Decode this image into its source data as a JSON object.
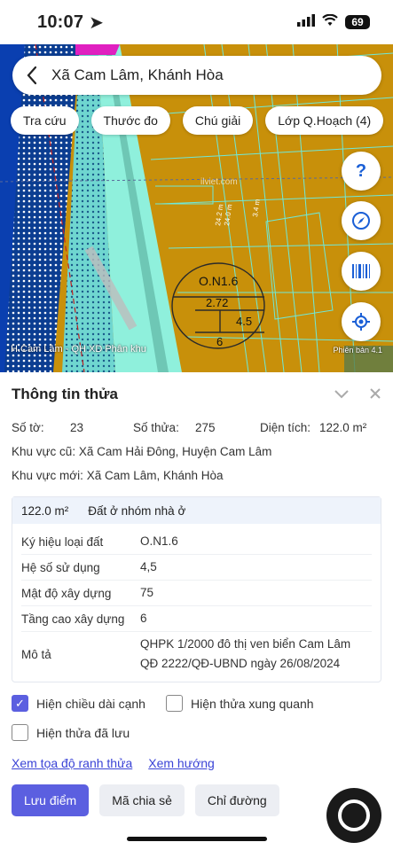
{
  "status": {
    "time": "10:07",
    "battery": "69"
  },
  "search": {
    "query": "Xã Cam Lâm, Khánh Hòa"
  },
  "chips": [
    "Tra cứu",
    "Thước đo",
    "Chú giải",
    "Lớp Q.Hoạch (4)"
  ],
  "map": {
    "watermark": "ilviet.com",
    "parcel_code": "O.N1.6",
    "parcel_far": "2.72",
    "parcel_ratio": "4.5",
    "parcel_floors": "6",
    "dim1": "24.2 m",
    "dim2": "24.0 m",
    "dim3": "3.4 m",
    "layer_label": "H.Cam Lâm - QH XD Phân khu",
    "version": "Phiên bản 4.1"
  },
  "info": {
    "title": "Thông tin thửa",
    "so_to_label": "Số tờ:",
    "so_to": "23",
    "so_thua_label": "Số thửa:",
    "so_thua": "275",
    "dien_tich_label": "Diện tích:",
    "dien_tich": "122.0 m²",
    "khu_vuc_cu_label": "Khu vực cũ:",
    "khu_vuc_cu": "Xã Cam Hải Đông, Huyện Cam Lâm",
    "khu_vuc_moi_label": "Khu vực mới:",
    "khu_vuc_moi": "Xã Cam Lâm, Khánh Hòa",
    "box_area": "122.0 m²",
    "box_type": "Đất ở nhóm nhà ở",
    "rows": [
      {
        "k": "Ký hiệu loại đất",
        "v": "O.N1.6"
      },
      {
        "k": "Hệ số sử dụng",
        "v": "4,5"
      },
      {
        "k": "Mật độ xây dựng",
        "v": "75"
      },
      {
        "k": "Tầng cao xây dựng",
        "v": "6"
      },
      {
        "k": "Mô tả",
        "v": "QHPK 1/2000 đô thị ven biển Cam Lâm QĐ 2222/QĐ-UBND ngày 26/08/2024"
      }
    ]
  },
  "checks": {
    "edge_length": "Hiện chiều dài cạnh",
    "neighbors": "Hiện thửa xung quanh",
    "saved": "Hiện thửa đã lưu"
  },
  "links": {
    "coords": "Xem tọa độ ranh thửa",
    "direction": "Xem hướng"
  },
  "buttons": {
    "save": "Lưu điểm",
    "share": "Mã chia sẻ",
    "route": "Chỉ đường"
  },
  "colors": {
    "accent": "#5b5fe0",
    "land": "#c8900a",
    "sea": "#0b3d91"
  }
}
